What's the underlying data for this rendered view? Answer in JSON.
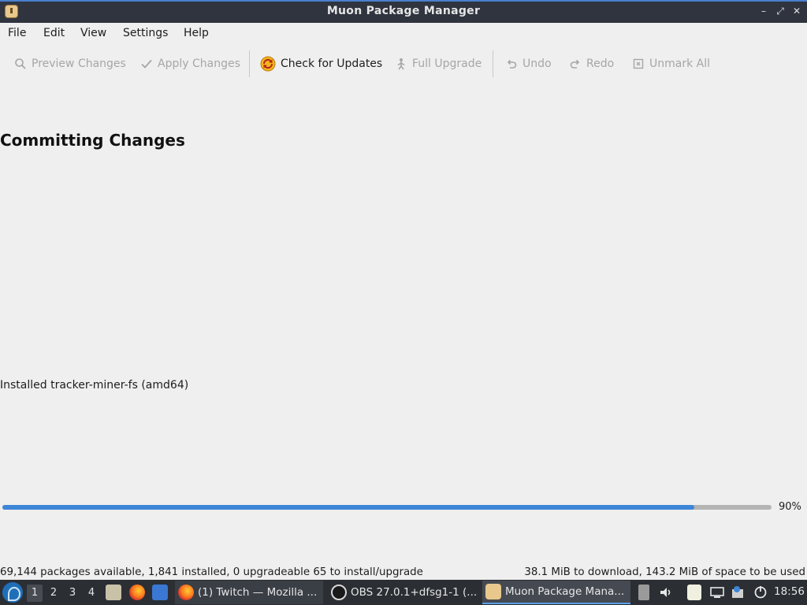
{
  "window": {
    "title": "Muon Package Manager",
    "controls": {
      "minimize": "–",
      "maximize": "⤢",
      "close": "✕"
    }
  },
  "menu": {
    "file": "File",
    "edit": "Edit",
    "view": "View",
    "settings": "Settings",
    "help": "Help"
  },
  "toolbar": {
    "preview": {
      "label": "Preview Changes",
      "icon": "search-icon",
      "enabled": false
    },
    "apply": {
      "label": "Apply Changes",
      "icon": "checkmark-icon",
      "enabled": false
    },
    "check_updates": {
      "label": "Check for Updates",
      "icon": "refresh-icon",
      "enabled": true
    },
    "full_upgrade": {
      "label": "Full Upgrade",
      "icon": "upgrade-icon",
      "enabled": false
    },
    "undo": {
      "label": "Undo",
      "icon": "undo-icon",
      "enabled": false
    },
    "redo": {
      "label": "Redo",
      "icon": "redo-icon",
      "enabled": false
    },
    "unmark_all": {
      "label": "Unmark All",
      "icon": "unmark-icon",
      "enabled": false
    }
  },
  "main": {
    "heading": "Committing Changes",
    "status_message": "Installed tracker-miner-fs (amd64)",
    "progress_percent": 90,
    "progress_label": "90%"
  },
  "statusbar": {
    "left": "69,144 packages available, 1,841 installed, 0 upgradeable 65 to install/upgrade",
    "right": "38.1 MiB to download, 143.2 MiB of space to be used"
  },
  "taskbar": {
    "workspaces": [
      "1",
      "2",
      "3",
      "4"
    ],
    "current_workspace": "1",
    "tasks": [
      {
        "label": "(1) Twitch — Mozilla ...",
        "icon": "firefox-icon"
      },
      {
        "label": "OBS 27.0.1+dfsg1-1 (...",
        "icon": "obs-icon"
      },
      {
        "label": "Muon Package Mana...",
        "icon": "muon-icon"
      }
    ],
    "clock": "18:56"
  },
  "colors": {
    "accent": "#3d86d8",
    "titlebar": "#2f343f",
    "taskbar": "#2b2e33",
    "window_bg": "#efefef"
  }
}
